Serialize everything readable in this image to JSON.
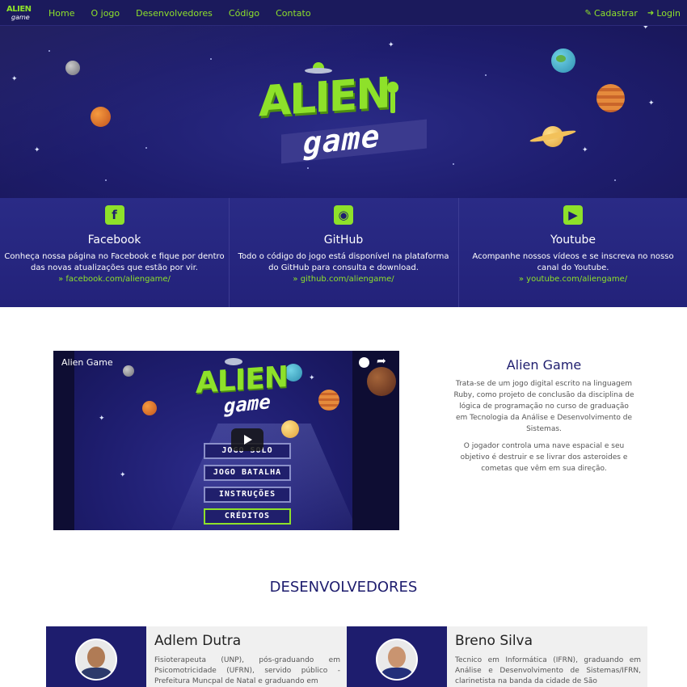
{
  "navbar": {
    "logo_top": "ALIEN",
    "logo_bottom": "game",
    "links": [
      "Home",
      "O jogo",
      "Desenvolvedores",
      "Código",
      "Contato"
    ],
    "signup_label": "Cadastrar",
    "login_label": "Login",
    "accent_color": "#8ee12a"
  },
  "hero": {
    "logo_title": "ALIEN",
    "logo_subtitle": "game"
  },
  "social": [
    {
      "icon": "facebook-icon",
      "icon_glyph": "f",
      "title": "Facebook",
      "text": "Conheça nossa página no Facebook e fique por dentro das novas atualizações que estão por vir.",
      "link": "» facebook.com/aliengame/"
    },
    {
      "icon": "github-icon",
      "icon_glyph": "◉",
      "title": "GitHub",
      "text": "Todo o código do jogo está disponível na plataforma do GitHub para consulta e download.",
      "link": "» github.com/aliengame/"
    },
    {
      "icon": "youtube-icon",
      "icon_glyph": "▶",
      "title": "Youtube",
      "text": "Acompanhe nossos vídeos e se inscreva no nosso canal do Youtube.",
      "link": "» youtube.com/aliengame/"
    }
  ],
  "video": {
    "title": "Alien Game",
    "logo_title": "ALIEN",
    "logo_subtitle": "game",
    "menu": [
      "JOGO SOLO",
      "JOGO BATALHA",
      "INSTRUÇÕES",
      "CRÉDITOS"
    ],
    "selected_menu": "CRÉDITOS"
  },
  "about": {
    "title": "Alien Game",
    "paragraphs": [
      "Trata-se de um jogo digital escrito na linguagem Ruby, como projeto de conclusão da disciplina de lógica de programação no curso de graduação em Tecnologia da Análise e Desenvolvimento de Sistemas.",
      "O jogador controla uma nave espacial e seu objetivo é destruir e se livrar dos asteroides e cometas que vêm em sua direção."
    ]
  },
  "developers": {
    "heading": "DESENVOLVEDORES",
    "people": [
      {
        "name": "Adlem Dutra",
        "bio": "Fisioterapeuta (UNP), pós-graduando em Psicomotricidade (UFRN), servido público - Prefeitura Muncpal de Natal e graduando em"
      },
      {
        "name": "Breno Silva",
        "bio": "Tecnico em Informática (IFRN), graduando em Análise e Desenvolvimento de Sistemas/IFRN, clarinetista na banda da cidade de São"
      }
    ]
  }
}
